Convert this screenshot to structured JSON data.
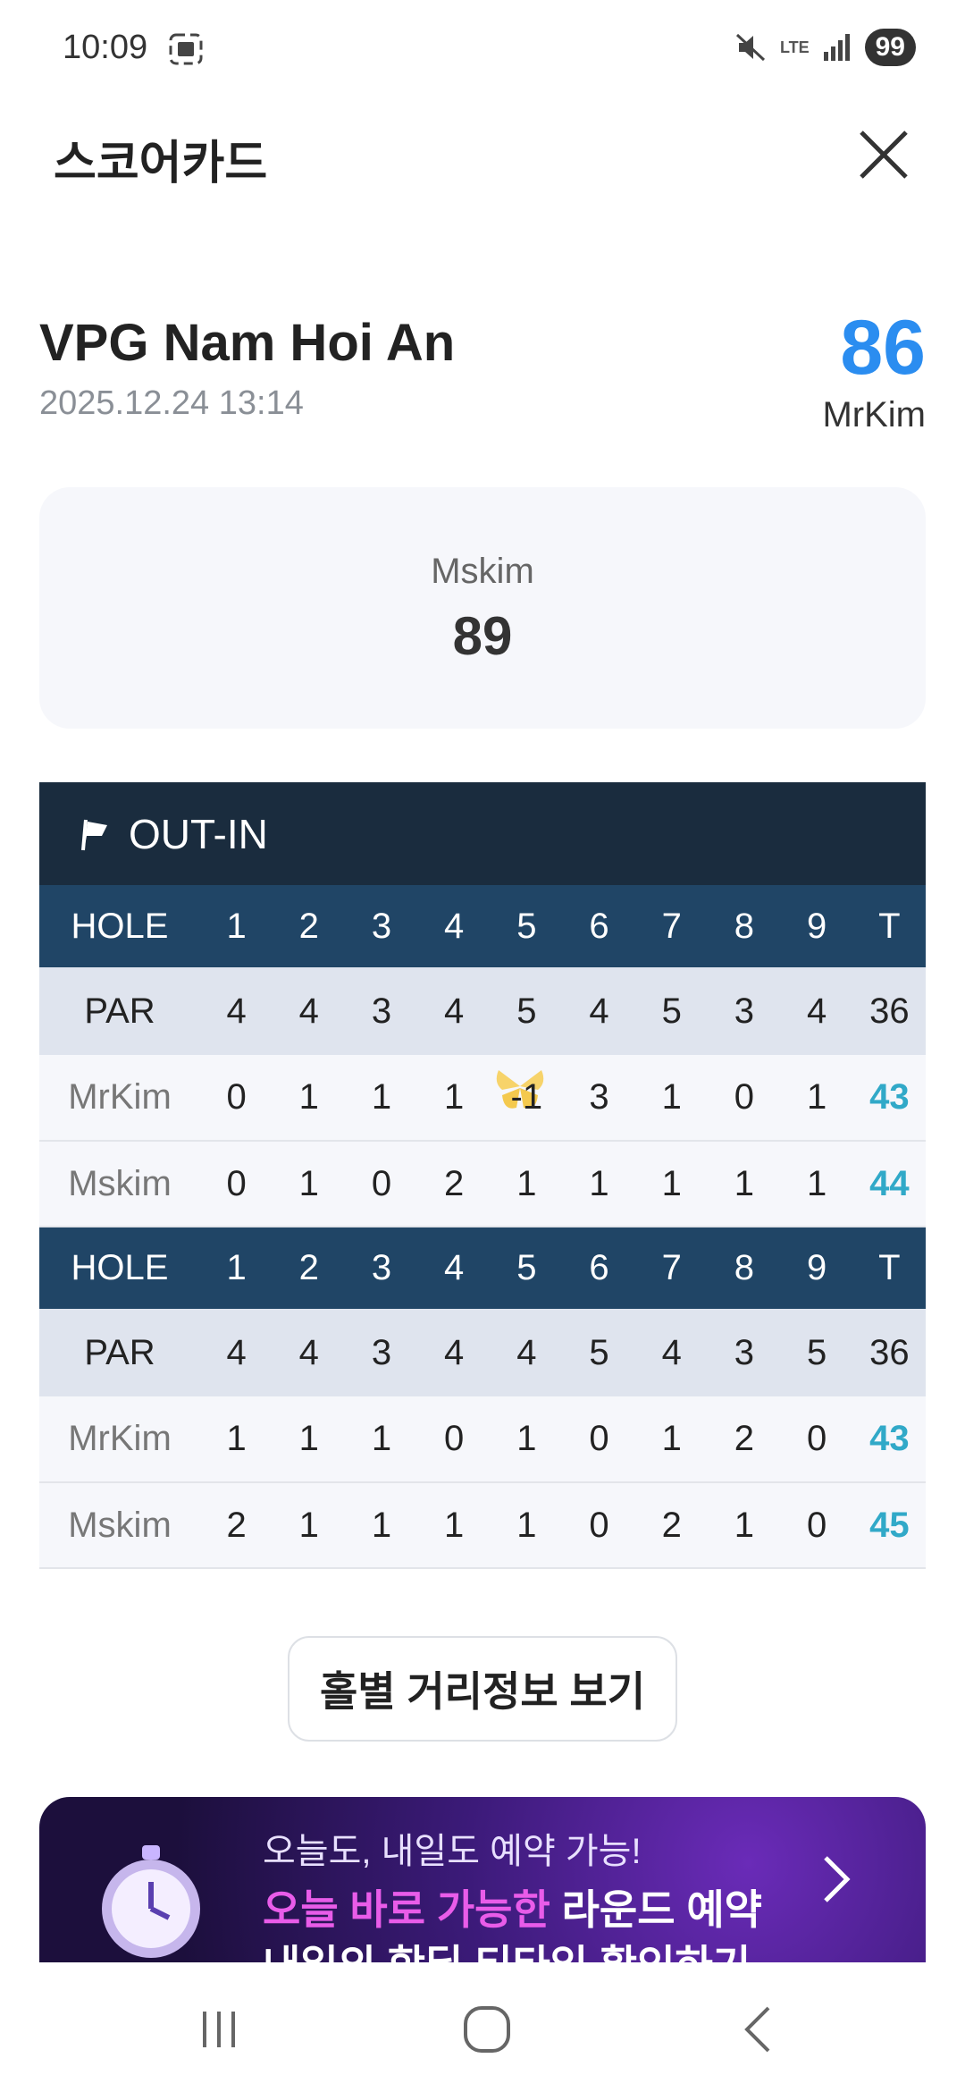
{
  "status": {
    "time": "10:09",
    "lte": "LTE",
    "battery": "99"
  },
  "header": {
    "title": "스코어카드"
  },
  "course": {
    "name": "VPG Nam Hoi An",
    "datetime": "2025.12.24 13:14"
  },
  "me": {
    "name": "MrKim",
    "score": "86",
    "accent": "#2b8df0"
  },
  "opponent": {
    "name": "Mskim",
    "score": "89"
  },
  "scorecard": {
    "course_label": "OUT-IN",
    "out": {
      "hole_label": "HOLE",
      "holes": [
        "1",
        "2",
        "3",
        "4",
        "5",
        "6",
        "7",
        "8",
        "9",
        "T"
      ],
      "par_label": "PAR",
      "par": [
        "4",
        "4",
        "3",
        "4",
        "5",
        "4",
        "5",
        "3",
        "4",
        "36"
      ],
      "players": [
        {
          "name": "MrKim",
          "scores": [
            "0",
            "1",
            "1",
            "1",
            "-1",
            "3",
            "1",
            "0",
            "1"
          ],
          "total": "43"
        },
        {
          "name": "Mskim",
          "scores": [
            "0",
            "1",
            "0",
            "2",
            "1",
            "1",
            "1",
            "1",
            "1"
          ],
          "total": "44"
        }
      ]
    },
    "in": {
      "hole_label": "HOLE",
      "holes": [
        "1",
        "2",
        "3",
        "4",
        "5",
        "6",
        "7",
        "8",
        "9",
        "T"
      ],
      "par_label": "PAR",
      "par": [
        "4",
        "4",
        "3",
        "4",
        "4",
        "5",
        "4",
        "3",
        "5",
        "36"
      ],
      "players": [
        {
          "name": "MrKim",
          "scores": [
            "1",
            "1",
            "1",
            "0",
            "1",
            "0",
            "1",
            "2",
            "0"
          ],
          "total": "43"
        },
        {
          "name": "Mskim",
          "scores": [
            "2",
            "1",
            "1",
            "1",
            "1",
            "0",
            "2",
            "1",
            "0"
          ],
          "total": "45"
        }
      ]
    }
  },
  "distance_button": {
    "label": "홀별 거리정보 보기"
  },
  "banner": {
    "line1": "오늘도, 내일도 예약 가능!",
    "line2_highlight": "오늘 바로 가능한",
    "line2_rest": " 라운드 예약",
    "line3": "내일의 핫딜 티타임 확인하기"
  },
  "icons": {
    "screenshot": "screenshot-icon",
    "mute": "mute-icon",
    "signal": "signal-icon",
    "close": "close-icon",
    "flag": "flag-icon",
    "birdie": "birdie-badge-icon",
    "clock": "stopwatch-icon",
    "chevron": "chevron-right-icon",
    "recent": "recent-apps-icon",
    "home": "home-icon",
    "back": "back-icon"
  }
}
